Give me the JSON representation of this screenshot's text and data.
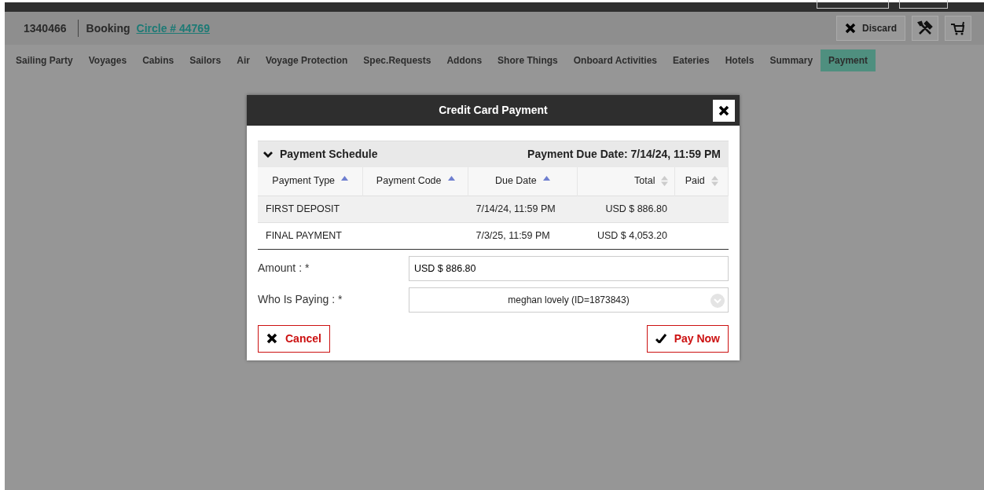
{
  "header": {
    "booking_number": "1340466",
    "booking_label": "Booking",
    "booking_link": "Circle # 44769",
    "discard_button": "Discard"
  },
  "tabs": [
    {
      "label": "Sailing Party",
      "selected": false
    },
    {
      "label": "Voyages",
      "selected": false
    },
    {
      "label": "Cabins",
      "selected": false
    },
    {
      "label": "Sailors",
      "selected": false
    },
    {
      "label": "Air",
      "selected": false
    },
    {
      "label": "Voyage Protection",
      "selected": false
    },
    {
      "label": "Spec.Requests",
      "selected": false
    },
    {
      "label": "Addons",
      "selected": false
    },
    {
      "label": "Shore Things",
      "selected": false
    },
    {
      "label": "Onboard Activities",
      "selected": false
    },
    {
      "label": "Eateries",
      "selected": false
    },
    {
      "label": "Hotels",
      "selected": false
    },
    {
      "label": "Summary",
      "selected": false
    },
    {
      "label": "Payment",
      "selected": true
    }
  ],
  "dialog": {
    "title": "Credit Card Payment",
    "schedule": {
      "title": "Payment Schedule",
      "expanded": true,
      "due_date": "Payment Due Date: 7/14/24, 11:59 PM",
      "columns": [
        {
          "label": "Payment Type",
          "sorted": true
        },
        {
          "label": "Payment Code",
          "sorted": true
        },
        {
          "label": "Due Date",
          "sorted": true
        },
        {
          "label": "Total",
          "sorted": false
        },
        {
          "label": "Paid",
          "sorted": false
        }
      ],
      "rows": [
        [
          "FIRST DEPOSIT",
          "",
          "7/14/24, 11:59 PM",
          "USD $ 886.80",
          ""
        ],
        [
          "FINAL PAYMENT",
          "",
          "7/3/25, 11:59 PM",
          "USD $ 4,053.20",
          ""
        ]
      ]
    },
    "amount": {
      "label": "Amount : *",
      "value": "USD $ 886.80"
    },
    "payer": {
      "label": "Who Is Paying : *",
      "value": "meghan lovely (ID=1873843)"
    },
    "cancel_button": "Cancel",
    "pay_button": "Pay Now"
  }
}
